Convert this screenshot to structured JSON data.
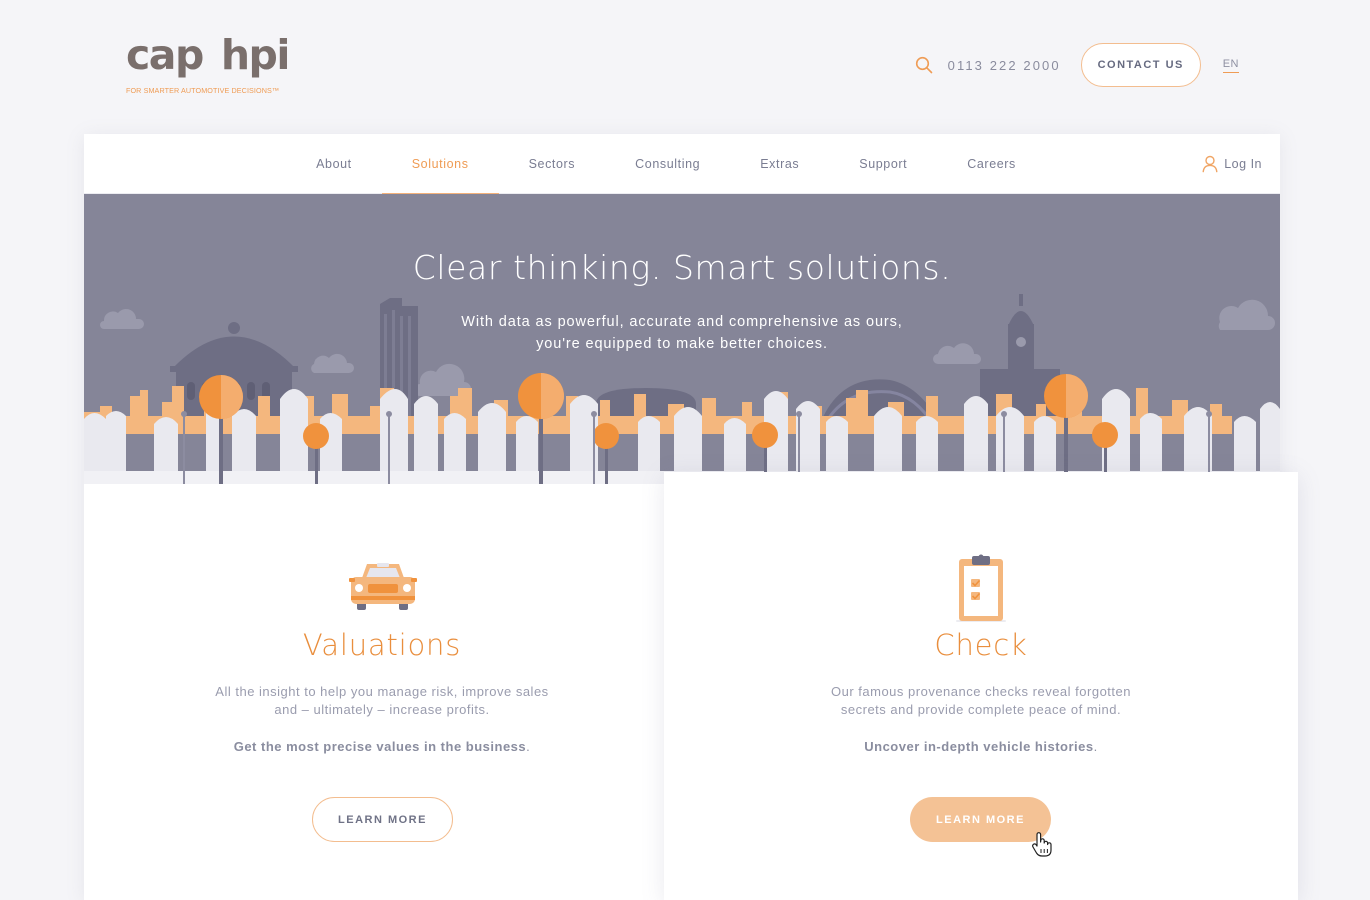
{
  "brand": {
    "logo_word_1": "cap",
    "logo_word_2": "hpi",
    "tagline": "FOR SMARTER AUTOMOTIVE DECISIONS™"
  },
  "header": {
    "phone": "0113 222 2000",
    "contact_label": "CONTACT US",
    "language": "EN"
  },
  "nav": {
    "items": [
      {
        "label": "About"
      },
      {
        "label": "Solutions",
        "active": true
      },
      {
        "label": "Sectors"
      },
      {
        "label": "Consulting"
      },
      {
        "label": "Extras"
      },
      {
        "label": "Support"
      },
      {
        "label": "Careers"
      }
    ],
    "login_label": "Log In"
  },
  "hero": {
    "title": "Clear thinking. Smart solutions.",
    "subtitle_line_1": "With data as powerful, accurate and comprehensive as ours,",
    "subtitle_line_2": "you're equipped to make better choices."
  },
  "products": [
    {
      "icon": "car-icon",
      "title": "Valuations",
      "desc_line_1": "All the insight to help you manage risk, improve sales",
      "desc_line_2": "and – ultimately – increase profits.",
      "strong": "Get the most precise values in the business",
      "button": "LEARN MORE"
    },
    {
      "icon": "clipboard-icon",
      "title": "Check",
      "desc_line_1": "Our famous provenance checks reveal forgotten",
      "desc_line_2": "secrets and provide complete peace of mind.",
      "strong": "Uncover in-depth vehicle histories",
      "button": "LEARN MORE"
    }
  ],
  "colors": {
    "accent": "#ef9c55",
    "accent_light": "#f4c295",
    "hero_bg": "#858598",
    "text": "#7a7d92"
  }
}
